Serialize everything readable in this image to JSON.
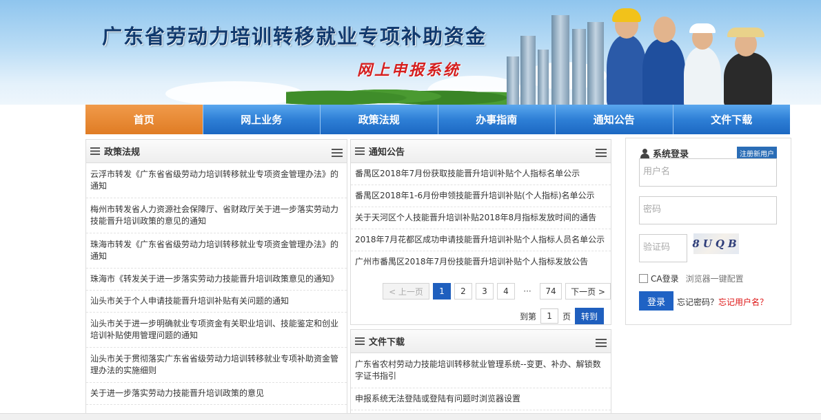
{
  "header": {
    "title": "广东省劳动力培训转移就业专项补助资金",
    "subtitle": "网上申报系统"
  },
  "nav": {
    "items": [
      {
        "label": "首页",
        "active": true
      },
      {
        "label": "网上业务",
        "active": false
      },
      {
        "label": "政策法规",
        "active": false
      },
      {
        "label": "办事指南",
        "active": false
      },
      {
        "label": "通知公告",
        "active": false
      },
      {
        "label": "文件下载",
        "active": false
      }
    ]
  },
  "policy": {
    "title": "政策法规",
    "items": [
      "云浮市转发《广东省省级劳动力培训转移就业专项资金管理办法》的通知",
      "梅州市转发省人力资源社会保障厅、省财政厅关于进一步落实劳动力技能晋升培训政策的意见的通知",
      "珠海市转发《广东省省级劳动力培训转移就业专项资金管理办法》的通知",
      "珠海市《转发关于进一步落实劳动力技能晋升培训政策意见的通知》",
      "汕头市关于个人申请技能晋升培训补贴有关问题的通知",
      "汕头市关于进一步明确就业专项资金有关职业培训、技能鉴定和创业培训补贴使用管理问题的通知",
      "汕头市关于贯彻落实广东省省级劳动力培训转移就业专项补助资金管理办法的实施细则",
      "关于进一步落实劳动力技能晋升培训政策的意见"
    ]
  },
  "notice": {
    "title": "通知公告",
    "items": [
      "番禺区2018年7月份获取技能晋升培训补贴个人指标名单公示",
      "番禺区2018年1-6月份申领技能晋升培训补贴(个人指标)名单公示",
      "关于天河区个人技能晋升培训补贴2018年8月指标发放时间的通告",
      "2018年7月花都区成功申请技能晋升培训补贴个人指标人员名单公示",
      "广州市番禺区2018年7月份技能晋升培训补贴个人指标发放公告"
    ],
    "pager": {
      "prev": "< 上一页",
      "pages": [
        "1",
        "2",
        "3",
        "4"
      ],
      "ellipsis": "···",
      "last": "74",
      "next": "下一页 >",
      "goto_prefix": "到第",
      "goto_value": "1",
      "goto_suffix": "页",
      "goto_button": "转到"
    }
  },
  "downloads": {
    "title": "文件下载",
    "items": [
      "广东省农村劳动力技能培训转移就业管理系统--变更、补办、解锁数字证书指引",
      "申报系统无法登陆或登陆有问题时浏览器设置"
    ]
  },
  "login": {
    "title": "系统登录",
    "register": "注册新用户",
    "username_placeholder": "用户名",
    "password_placeholder": "密码",
    "captcha_placeholder": "验证码",
    "captcha_text": "8UQB",
    "ca_label": "CA登录",
    "browser_config": "浏览器一键配置",
    "login_button": "登录",
    "forgot_password": "忘记密码？",
    "forgot_username": "忘记用户名？"
  }
}
